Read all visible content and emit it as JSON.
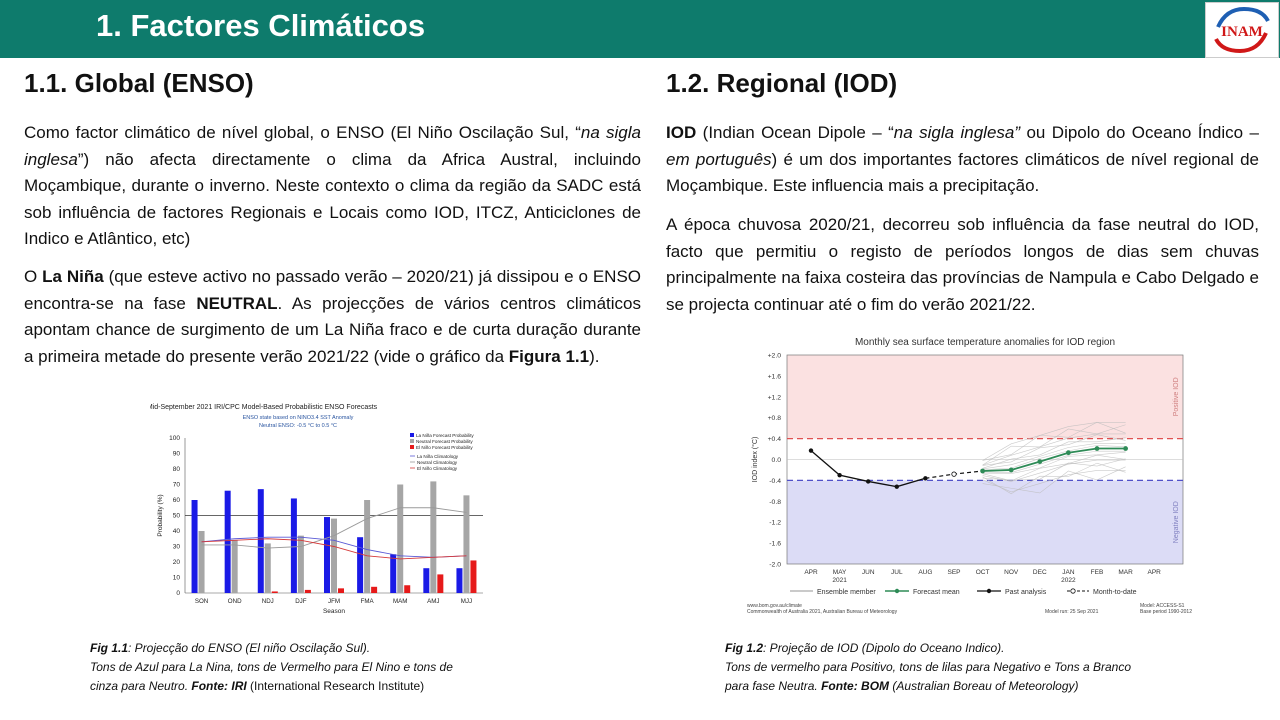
{
  "header": {
    "title": "1. Factores Climáticos",
    "logo_text": "INAM"
  },
  "left": {
    "heading": "1.1.  Global (ENSO)",
    "p1": {
      "a": "Como factor climático de nível global, o ENSO (El Niño Oscilação Sul, “",
      "b": "na sigla inglesa",
      "c": "”) não afecta directamente o clima da Africa Austral, incluindo Moçambique, durante o inverno. Neste contexto o clima da região da SADC está sob influência de factores Regionais e Locais como IOD, ITCZ, Anticiclones de Indico e Atlântico, etc)"
    },
    "p2": {
      "a": "O ",
      "b": "La Niña",
      "c": " (que esteve activo no passado verão – 2020/21) já dissipou e o ENSO encontra-se na fase ",
      "d": "NEUTRAL",
      "e": ". As projecções de vários centros climáticos apontam chance de surgimento de um La Niña fraco e de curta duração durante a primeira  metade do presente verão 2021/22 (vide o gráfico da ",
      "f": "Figura 1.1",
      "g": ")."
    },
    "caption": {
      "l1_bold": "Fig 1.1",
      "l1_rest": ": Projecção do ENSO (El niño Oscilação Sul).",
      "l2": "Tons de Azul para La Nina, tons de Vermelho para El Nino e tons de",
      "l3_a": "cinza para Neutro. ",
      "l3_bold": "Fonte: IRI",
      "l3_rest": " (International Research Institute)"
    }
  },
  "right": {
    "heading": "1.2. Regional (IOD)",
    "p1": {
      "a": "IOD",
      "b": " (Indian Ocean Dipole – “",
      "c": "na sigla inglesa”",
      "d": " ou Dipolo do Oceano Índico – ",
      "e": "em português",
      "f": ") é um dos importantes factores climáticos de nível regional de Moçambique. Este influencia mais a precipitação."
    },
    "p2": "A época chuvosa 2020/21, decorreu sob influência da fase neutral do IOD, facto que permitiu o registo de períodos longos de dias sem chuvas principalmente na faixa costeira das províncias de Nampula e Cabo Delgado e se projecta continuar até o fim do verão 2021/22.",
    "caption": {
      "l1_bold": "Fig 1.2",
      "l1_rest": ": Projeção de IOD (Dipolo do Oceano Indico).",
      "l2": "Tons de vermelho para Positivo, tons de lilas para Negativo e Tons a Branco",
      "l3_a": "para fase Neutra. ",
      "l3_bold": "Fonte: BOM",
      "l3_rest": " (Australian Boreau of Meteorology)"
    }
  },
  "chart_data": [
    {
      "type": "bar",
      "title": "Mid-September 2021 IRI/CPC Model-Based Probabilistic ENSO Forecasts",
      "subtitle": [
        "ENSO state based on NINO3.4 SST Anomaly",
        "Neutral ENSO: -0.5 °C to 0.5 °C"
      ],
      "xlabel": "Season",
      "ylabel": "Probability (%)",
      "ylim": [
        0,
        100
      ],
      "yticks": [
        0,
        10,
        20,
        30,
        40,
        50,
        60,
        70,
        80,
        90,
        100
      ],
      "categories": [
        "SON",
        "OND",
        "NDJ",
        "DJF",
        "JFM",
        "FMA",
        "MAM",
        "AMJ",
        "MJJ"
      ],
      "series": [
        {
          "name": "La Niña Forecast Probability",
          "color": "#1a1ae6",
          "values": [
            60,
            66,
            67,
            61,
            49,
            36,
            25,
            16,
            16
          ]
        },
        {
          "name": "Neutral Forecast Probability",
          "color": "#a6a6a6",
          "values": [
            40,
            34,
            32,
            37,
            48,
            60,
            70,
            72,
            63
          ]
        },
        {
          "name": "El Niño Forecast Probability",
          "color": "#e61a1a",
          "values": [
            0,
            0,
            1,
            2,
            3,
            4,
            5,
            12,
            21
          ]
        }
      ],
      "lines": [
        {
          "name": "La Niña Climatology",
          "color": "#5a5ad6",
          "values": [
            33,
            35,
            36,
            36,
            34,
            28,
            24,
            23,
            24
          ]
        },
        {
          "name": "Neutral Climatology",
          "color": "#9a9a9a",
          "values": [
            31,
            31,
            29,
            30,
            37,
            48,
            55,
            55,
            52
          ]
        },
        {
          "name": "El Niño Climatology",
          "color": "#d63a3a",
          "values": [
            33,
            34,
            35,
            34,
            30,
            24,
            22,
            23,
            24
          ]
        }
      ],
      "reference_line": 50,
      "legend": "top-right"
    },
    {
      "type": "line",
      "title": "Monthly sea surface temperature anomalies for IOD region",
      "ylabel": "IOD index (°C)",
      "ylim": [
        -2.0,
        2.0
      ],
      "yticks": [
        "-2.0",
        "-1.6",
        "-1.2",
        "-0.8",
        "-0.4",
        "0.0",
        "+0.4",
        "+0.8",
        "+1.2",
        "+1.6",
        "+2.0"
      ],
      "x": [
        "APR",
        "MAY",
        "JUN",
        "JUL",
        "AUG",
        "SEP",
        "OCT",
        "NOV",
        "DEC",
        "JAN",
        "FEB",
        "MAR",
        "APR"
      ],
      "x_sublabels": {
        "MAY": "2021",
        "JAN": "2022"
      },
      "thresholds": [
        0.4,
        -0.4
      ],
      "bands": {
        "positive_label": "Positive IOD",
        "negative_label": "Negative IOD"
      },
      "past_analysis": {
        "x": [
          "APR",
          "MAY",
          "JUN",
          "JUL",
          "AUG"
        ],
        "values": [
          0.17,
          -0.3,
          -0.42,
          -0.52,
          -0.36
        ]
      },
      "month_to_date": {
        "x": [
          "AUG",
          "SEP",
          "OCT"
        ],
        "values": [
          -0.36,
          -0.28,
          -0.22
        ]
      },
      "forecast_mean": {
        "x": [
          "OCT",
          "NOV",
          "DEC",
          "JAN",
          "FEB",
          "MAR"
        ],
        "values": [
          -0.22,
          -0.2,
          -0.04,
          0.13,
          0.21,
          0.21
        ]
      },
      "legend": [
        "Ensemble member",
        "Forecast mean",
        "Past analysis",
        "Month-to-date"
      ],
      "footer": {
        "left1": "www.bom.gov.au/climate",
        "left2": "Commonwealth of Australia 2021, Australian Bureau of Meteorology",
        "mid": "Model run: 25 Sep 2021",
        "right1": "Model: ACCESS-S1",
        "right2": "Base period 1990-2012"
      }
    }
  ]
}
